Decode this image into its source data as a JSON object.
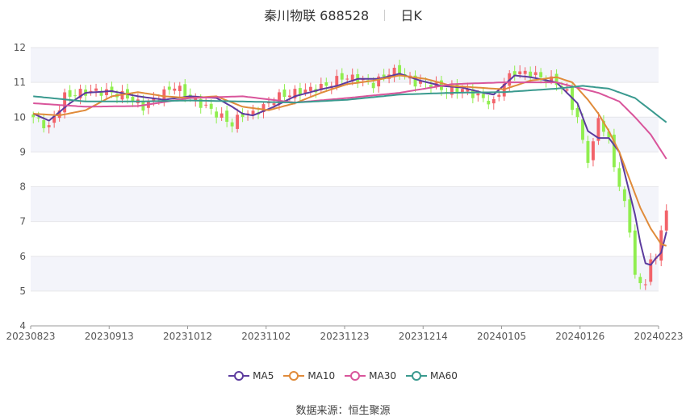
{
  "header": {
    "stock": "秦川物联 688528",
    "period": "日K"
  },
  "source": "数据来源：恒生聚源",
  "colors": {
    "up": "#f2636a",
    "down": "#90ee4f",
    "grid": "#e6e6ea",
    "band": "#f3f4fa"
  },
  "chart_data": {
    "type": "line",
    "title": "秦川物联 688528 日K",
    "ylim": [
      4,
      12
    ],
    "yticks": [
      4,
      5,
      6,
      7,
      8,
      9,
      10,
      11,
      12
    ],
    "xticks": [
      "20230823",
      "20230913",
      "20231012",
      "20231102",
      "20231123",
      "20231214",
      "20240105",
      "20240126",
      "20240223"
    ],
    "n_days": 120,
    "series": [
      {
        "name": "MA5",
        "color": "#5c3b9e",
        "keys": [
          [
            0,
            10.1
          ],
          [
            3,
            9.9
          ],
          [
            7,
            10.4
          ],
          [
            10,
            10.7
          ],
          [
            15,
            10.75
          ],
          [
            20,
            10.6
          ],
          [
            25,
            10.5
          ],
          [
            30,
            10.6
          ],
          [
            35,
            10.55
          ],
          [
            38,
            10.3
          ],
          [
            40,
            10.1
          ],
          [
            42,
            10.05
          ],
          [
            46,
            10.3
          ],
          [
            50,
            10.6
          ],
          [
            55,
            10.8
          ],
          [
            58,
            10.9
          ],
          [
            62,
            11.1
          ],
          [
            66,
            11.1
          ],
          [
            70,
            11.25
          ],
          [
            74,
            11.05
          ],
          [
            78,
            10.9
          ],
          [
            82,
            10.85
          ],
          [
            86,
            10.7
          ],
          [
            88,
            10.65
          ],
          [
            92,
            11.2
          ],
          [
            95,
            11.15
          ],
          [
            100,
            11.0
          ],
          [
            104,
            10.4
          ],
          [
            106,
            9.6
          ],
          [
            108,
            9.4
          ],
          [
            110,
            9.4
          ],
          [
            112,
            9.0
          ],
          [
            114,
            7.8
          ],
          [
            115,
            7.2
          ],
          [
            116,
            6.4
          ],
          [
            117,
            5.8
          ],
          [
            118,
            5.75
          ],
          [
            119,
            5.95
          ],
          [
            120,
            6.1
          ],
          [
            121,
            6.7
          ]
        ]
      },
      {
        "name": "MA10",
        "color": "#e08b3a",
        "keys": [
          [
            0,
            10.1
          ],
          [
            5,
            10.05
          ],
          [
            10,
            10.2
          ],
          [
            15,
            10.6
          ],
          [
            20,
            10.72
          ],
          [
            25,
            10.6
          ],
          [
            30,
            10.55
          ],
          [
            35,
            10.6
          ],
          [
            40,
            10.3
          ],
          [
            45,
            10.2
          ],
          [
            50,
            10.4
          ],
          [
            55,
            10.7
          ],
          [
            60,
            10.95
          ],
          [
            65,
            11.05
          ],
          [
            70,
            11.2
          ],
          [
            75,
            11.1
          ],
          [
            80,
            10.9
          ],
          [
            85,
            10.85
          ],
          [
            90,
            10.8
          ],
          [
            95,
            11.05
          ],
          [
            100,
            11.15
          ],
          [
            103,
            11.0
          ],
          [
            106,
            10.5
          ],
          [
            108,
            10.1
          ],
          [
            110,
            9.6
          ],
          [
            112,
            9.0
          ],
          [
            114,
            8.2
          ],
          [
            116,
            7.4
          ],
          [
            118,
            6.8
          ],
          [
            120,
            6.35
          ],
          [
            121,
            6.3
          ]
        ]
      },
      {
        "name": "MA30",
        "color": "#d9559b",
        "keys": [
          [
            0,
            10.4
          ],
          [
            10,
            10.3
          ],
          [
            20,
            10.32
          ],
          [
            30,
            10.55
          ],
          [
            40,
            10.6
          ],
          [
            50,
            10.42
          ],
          [
            60,
            10.55
          ],
          [
            70,
            10.7
          ],
          [
            80,
            10.95
          ],
          [
            90,
            11.0
          ],
          [
            100,
            11.0
          ],
          [
            104,
            10.85
          ],
          [
            108,
            10.7
          ],
          [
            112,
            10.45
          ],
          [
            115,
            10.0
          ],
          [
            118,
            9.5
          ],
          [
            121,
            8.8
          ]
        ]
      },
      {
        "name": "MA60",
        "color": "#3a9a8f",
        "keys": [
          [
            0,
            10.6
          ],
          [
            10,
            10.45
          ],
          [
            20,
            10.45
          ],
          [
            30,
            10.48
          ],
          [
            40,
            10.45
          ],
          [
            50,
            10.42
          ],
          [
            60,
            10.5
          ],
          [
            70,
            10.65
          ],
          [
            80,
            10.7
          ],
          [
            90,
            10.72
          ],
          [
            100,
            10.82
          ],
          [
            105,
            10.9
          ],
          [
            110,
            10.82
          ],
          [
            115,
            10.55
          ],
          [
            118,
            10.2
          ],
          [
            121,
            9.85
          ]
        ]
      }
    ],
    "candle_keys": [
      [
        0,
        10.0
      ],
      [
        3,
        9.7
      ],
      [
        6,
        10.6
      ],
      [
        9,
        10.7
      ],
      [
        12,
        10.75
      ],
      [
        15,
        10.7
      ],
      [
        18,
        10.6
      ],
      [
        21,
        10.3
      ],
      [
        24,
        10.6
      ],
      [
        27,
        10.9
      ],
      [
        30,
        10.55
      ],
      [
        33,
        10.3
      ],
      [
        36,
        10.0
      ],
      [
        38,
        9.8
      ],
      [
        40,
        10.1
      ],
      [
        42,
        10.1
      ],
      [
        44,
        10.3
      ],
      [
        47,
        10.6
      ],
      [
        50,
        10.7
      ],
      [
        53,
        10.8
      ],
      [
        56,
        10.9
      ],
      [
        59,
        11.15
      ],
      [
        62,
        11.1
      ],
      [
        65,
        10.95
      ],
      [
        68,
        11.3
      ],
      [
        70,
        11.3
      ],
      [
        73,
        11.0
      ],
      [
        76,
        10.95
      ],
      [
        79,
        10.75
      ],
      [
        82,
        10.8
      ],
      [
        85,
        10.6
      ],
      [
        88,
        10.4
      ],
      [
        90,
        11.0
      ],
      [
        92,
        11.3
      ],
      [
        95,
        11.25
      ],
      [
        98,
        11.1
      ],
      [
        100,
        11.0
      ],
      [
        102,
        10.7
      ],
      [
        104,
        9.95
      ],
      [
        105,
        9.3
      ],
      [
        106,
        8.8
      ],
      [
        107,
        9.2
      ],
      [
        108,
        10.0
      ],
      [
        110,
        9.3
      ],
      [
        112,
        8.0
      ],
      [
        113,
        7.5
      ],
      [
        114,
        6.8
      ],
      [
        115,
        5.4
      ],
      [
        116,
        5.2
      ],
      [
        117,
        5.3
      ],
      [
        118,
        5.8
      ],
      [
        119,
        6.0
      ],
      [
        120,
        6.8
      ],
      [
        121,
        7.2
      ]
    ],
    "legend": [
      "MA5",
      "MA10",
      "MA30",
      "MA60"
    ],
    "legend_position": "bottom",
    "grid": true
  }
}
